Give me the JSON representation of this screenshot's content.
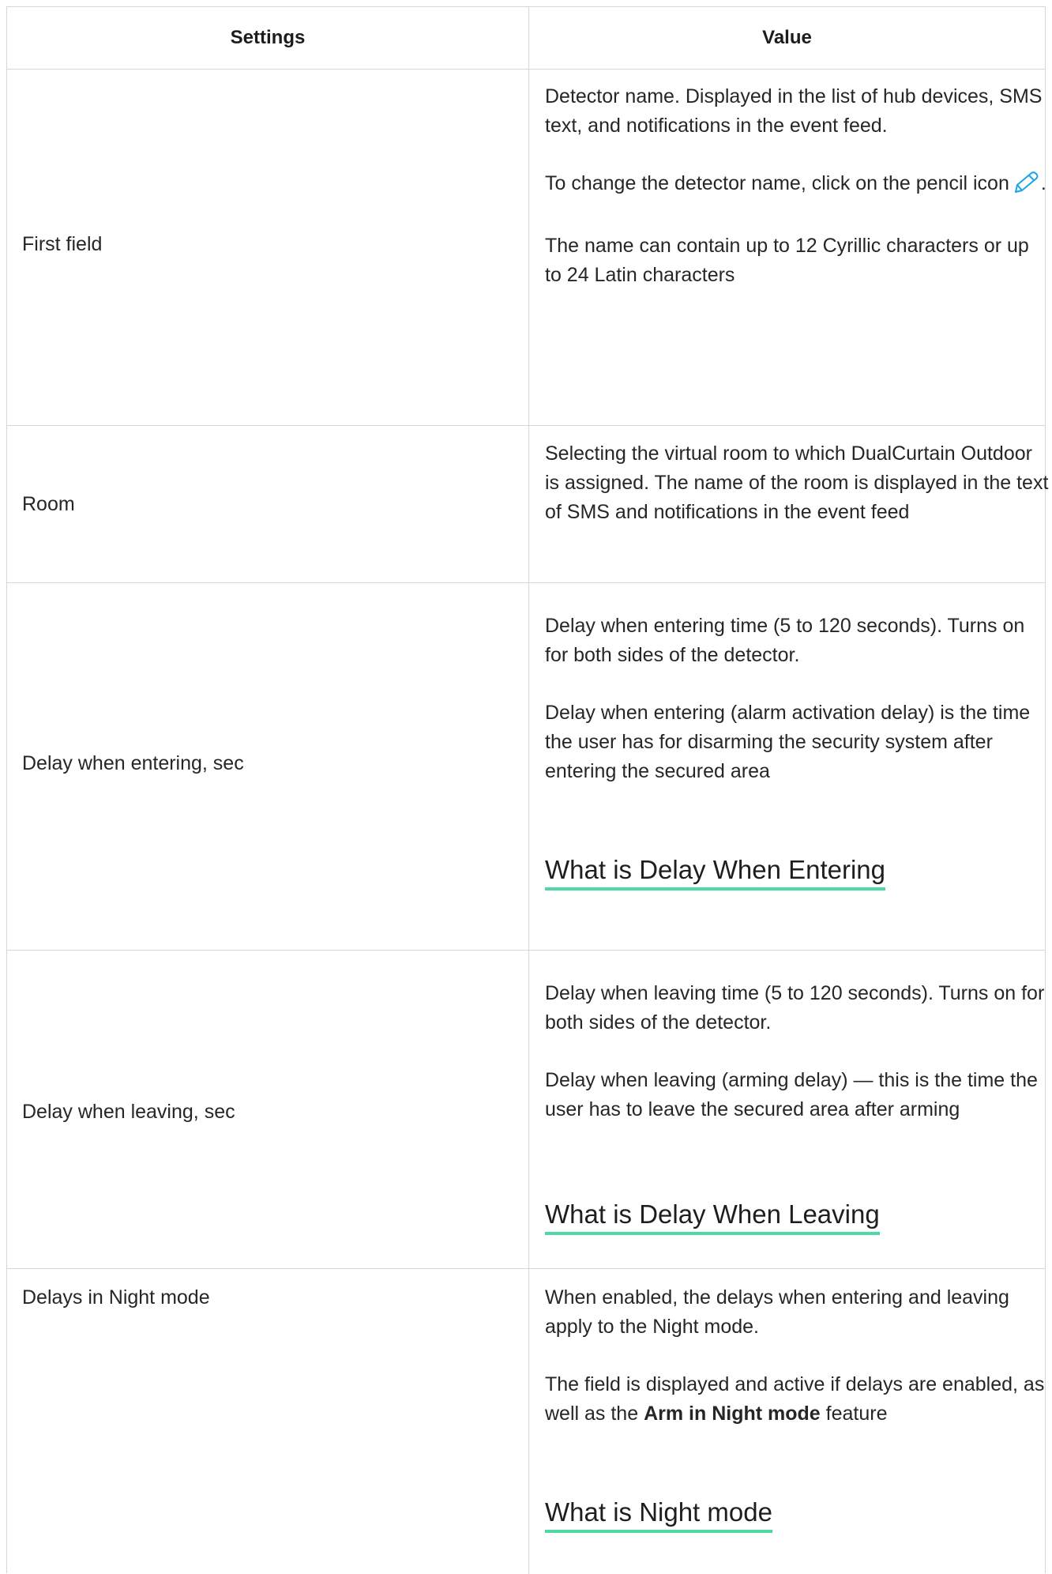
{
  "header": {
    "settings": "Settings",
    "value": "Value"
  },
  "rows": [
    {
      "setting": "First field",
      "paragraphs": [
        "Detector name. Displayed in the list of hub devices, SMS text, and notifications in the event feed.",
        "To change the detector name, click on the pencil icon",
        "The name can contain up to 12 Cyrillic characters or up to 24 Latin characters"
      ],
      "icon": "pencil-icon",
      "icon_suffix": "."
    },
    {
      "setting": "Room",
      "paragraphs": [
        "Selecting the virtual room to which DualCurtain Outdoor is assigned. The name of the room is displayed in the text of SMS and notifications in the event feed"
      ]
    },
    {
      "setting": "Delay when entering, sec",
      "paragraphs": [
        "Delay when entering time (5 to 120 seconds). Turns on for both sides of the detector.",
        "Delay when entering (alarm activation delay) is the time the user has for disarming the security system after entering the secured area"
      ],
      "link": "What is Delay When Entering"
    },
    {
      "setting": "Delay when leaving, sec",
      "paragraphs": [
        "Delay when leaving time (5 to 120 seconds). Turns on for both sides of the detector.",
        "Delay when leaving (arming delay) — this is the time the user has to leave the secured area after arming"
      ],
      "link": "What is Delay When Leaving"
    },
    {
      "setting": "Delays in Night mode",
      "paragraphs": [
        "When enabled, the delays when entering and leaving apply to the Night mode.",
        "The field is displayed and active if delays are enabled, as well as the",
        "Arm in Night mode",
        "feature"
      ],
      "link": "What is Night mode"
    }
  ],
  "colors": {
    "border": "#d7d7d7",
    "link_underline": "#4fd8a4",
    "icon": "#1aa3e8"
  }
}
